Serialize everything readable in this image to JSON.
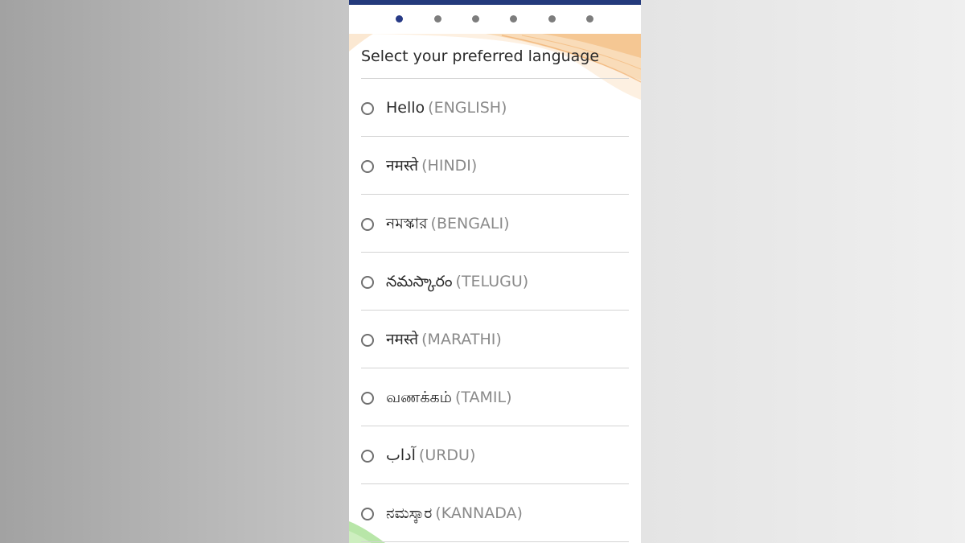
{
  "title": "Select your preferred language",
  "pager": {
    "total": 6,
    "active_index": 0
  },
  "languages": [
    {
      "native": "Hello",
      "english": "(ENGLISH)"
    },
    {
      "native": "नमस्ते",
      "english": "(HINDI)"
    },
    {
      "native": "নমস্কার",
      "english": "(BENGALI)"
    },
    {
      "native": "నమస్కారం",
      "english": "(TELUGU)"
    },
    {
      "native": "नमस्ते",
      "english": "(MARATHI)"
    },
    {
      "native": "வணக்கம்",
      "english": "(TAMIL)"
    },
    {
      "native": "آداب",
      "english": "(URDU)"
    },
    {
      "native": "ನಮಸ್ಕಾರ",
      "english": "(KANNADA)"
    }
  ],
  "colors": {
    "status_bar": "#243a7c",
    "active_dot": "#273a86",
    "inactive_dot": "#7d7d7d",
    "decor_saffron": "#f3b774",
    "decor_green": "#b8e6a8"
  }
}
